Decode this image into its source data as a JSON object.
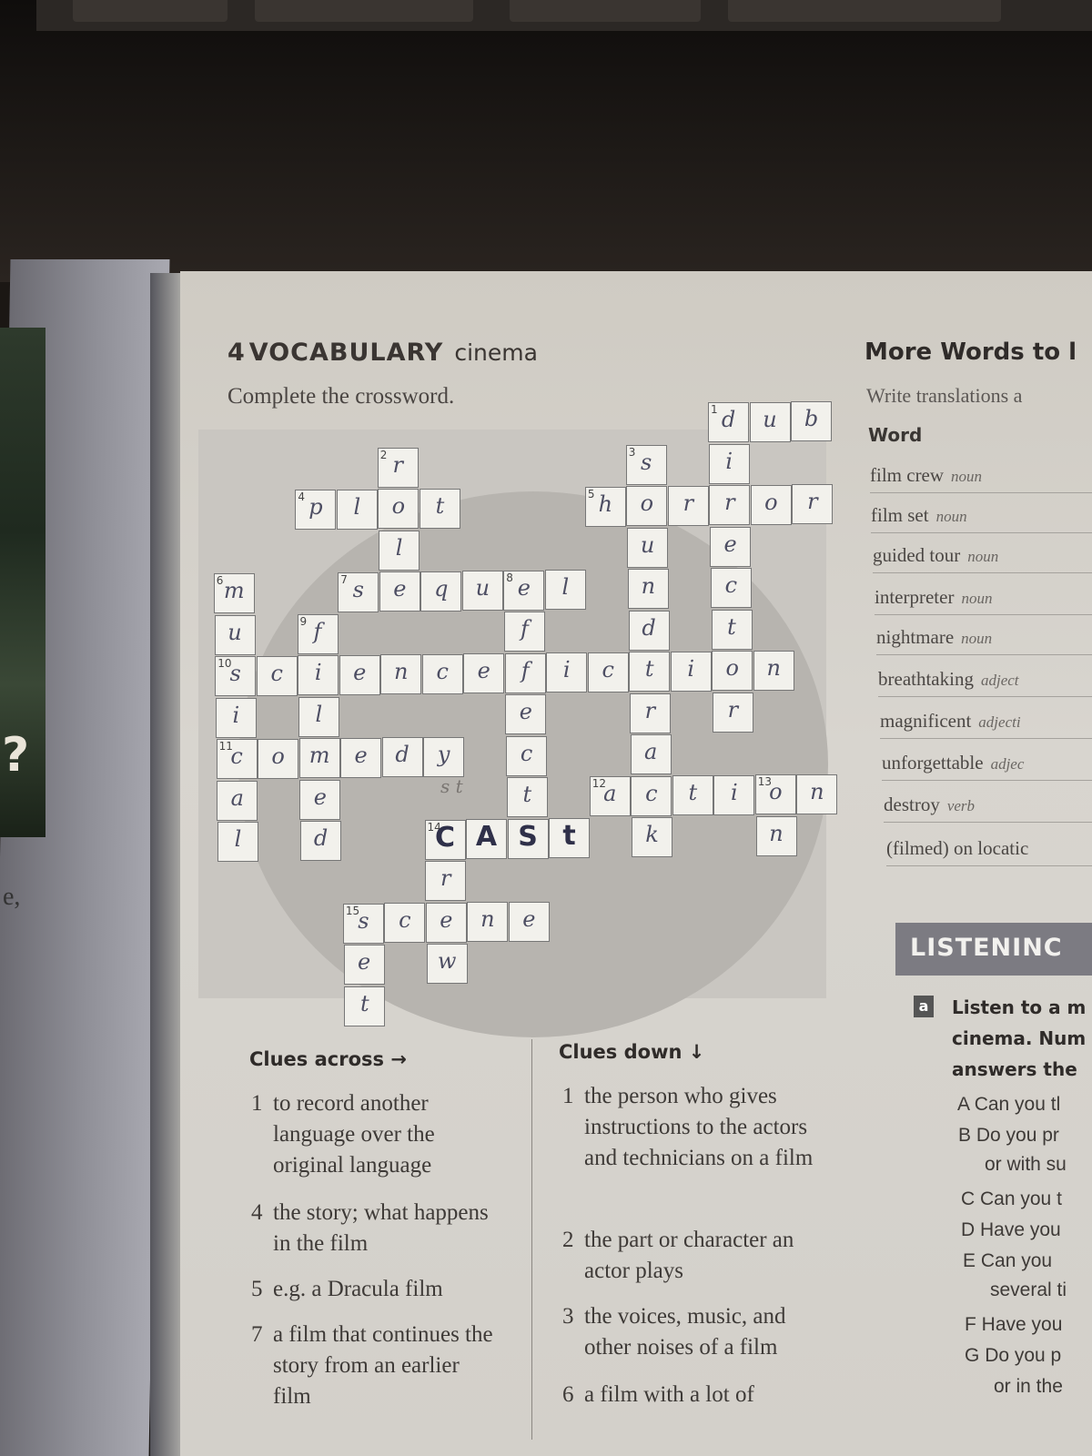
{
  "exercise": {
    "number": "4",
    "title": "VOCABULARY",
    "subtitle": "cinema",
    "instruction": "Complete the crossword."
  },
  "crossword": {
    "pencil_note": "s t",
    "cells": [
      {
        "row": 0,
        "col": 12,
        "num": "1",
        "letter": "d"
      },
      {
        "row": 0,
        "col": 13,
        "num": "",
        "letter": "u"
      },
      {
        "row": 0,
        "col": 14,
        "num": "",
        "letter": "b"
      },
      {
        "row": 1,
        "col": 4,
        "num": "2",
        "letter": "r"
      },
      {
        "row": 1,
        "col": 10,
        "num": "3",
        "letter": "s"
      },
      {
        "row": 1,
        "col": 12,
        "num": "",
        "letter": "i"
      },
      {
        "row": 2,
        "col": 2,
        "num": "4",
        "letter": "p"
      },
      {
        "row": 2,
        "col": 3,
        "num": "",
        "letter": "l"
      },
      {
        "row": 2,
        "col": 4,
        "num": "",
        "letter": "o"
      },
      {
        "row": 2,
        "col": 5,
        "num": "",
        "letter": "t"
      },
      {
        "row": 2,
        "col": 9,
        "num": "5",
        "letter": "h"
      },
      {
        "row": 2,
        "col": 10,
        "num": "",
        "letter": "o"
      },
      {
        "row": 2,
        "col": 11,
        "num": "",
        "letter": "r"
      },
      {
        "row": 2,
        "col": 12,
        "num": "",
        "letter": "r"
      },
      {
        "row": 2,
        "col": 13,
        "num": "",
        "letter": "o"
      },
      {
        "row": 2,
        "col": 14,
        "num": "",
        "letter": "r"
      },
      {
        "row": 3,
        "col": 4,
        "num": "",
        "letter": "l"
      },
      {
        "row": 3,
        "col": 10,
        "num": "",
        "letter": "u"
      },
      {
        "row": 3,
        "col": 12,
        "num": "",
        "letter": "e"
      },
      {
        "row": 4,
        "col": 0,
        "num": "6",
        "letter": "m"
      },
      {
        "row": 4,
        "col": 3,
        "num": "7",
        "letter": "s"
      },
      {
        "row": 4,
        "col": 4,
        "num": "",
        "letter": "e"
      },
      {
        "row": 4,
        "col": 5,
        "num": "",
        "letter": "q"
      },
      {
        "row": 4,
        "col": 6,
        "num": "",
        "letter": "u"
      },
      {
        "row": 4,
        "col": 7,
        "num": "8",
        "letter": "e"
      },
      {
        "row": 4,
        "col": 8,
        "num": "",
        "letter": "l"
      },
      {
        "row": 4,
        "col": 10,
        "num": "",
        "letter": "n"
      },
      {
        "row": 4,
        "col": 12,
        "num": "",
        "letter": "c"
      },
      {
        "row": 5,
        "col": 0,
        "num": "",
        "letter": "u"
      },
      {
        "row": 5,
        "col": 2,
        "num": "9",
        "letter": "f"
      },
      {
        "row": 5,
        "col": 7,
        "num": "",
        "letter": "f"
      },
      {
        "row": 5,
        "col": 10,
        "num": "",
        "letter": "d"
      },
      {
        "row": 5,
        "col": 12,
        "num": "",
        "letter": "t"
      },
      {
        "row": 6,
        "col": 0,
        "num": "10",
        "letter": "s"
      },
      {
        "row": 6,
        "col": 1,
        "num": "",
        "letter": "c"
      },
      {
        "row": 6,
        "col": 2,
        "num": "",
        "letter": "i"
      },
      {
        "row": 6,
        "col": 3,
        "num": "",
        "letter": "e"
      },
      {
        "row": 6,
        "col": 4,
        "num": "",
        "letter": "n"
      },
      {
        "row": 6,
        "col": 5,
        "num": "",
        "letter": "c"
      },
      {
        "row": 6,
        "col": 6,
        "num": "",
        "letter": "e"
      },
      {
        "row": 6,
        "col": 7,
        "num": "",
        "letter": "f"
      },
      {
        "row": 6,
        "col": 8,
        "num": "",
        "letter": "i"
      },
      {
        "row": 6,
        "col": 9,
        "num": "",
        "letter": "c"
      },
      {
        "row": 6,
        "col": 10,
        "num": "",
        "letter": "t"
      },
      {
        "row": 6,
        "col": 11,
        "num": "",
        "letter": "i"
      },
      {
        "row": 6,
        "col": 12,
        "num": "",
        "letter": "o"
      },
      {
        "row": 6,
        "col": 13,
        "num": "",
        "letter": "n"
      },
      {
        "row": 7,
        "col": 0,
        "num": "",
        "letter": "i"
      },
      {
        "row": 7,
        "col": 2,
        "num": "",
        "letter": "l"
      },
      {
        "row": 7,
        "col": 7,
        "num": "",
        "letter": "e"
      },
      {
        "row": 7,
        "col": 10,
        "num": "",
        "letter": "r"
      },
      {
        "row": 7,
        "col": 12,
        "num": "",
        "letter": "r"
      },
      {
        "row": 8,
        "col": 0,
        "num": "11",
        "letter": "c"
      },
      {
        "row": 8,
        "col": 1,
        "num": "",
        "letter": "o"
      },
      {
        "row": 8,
        "col": 2,
        "num": "",
        "letter": "m"
      },
      {
        "row": 8,
        "col": 3,
        "num": "",
        "letter": "e"
      },
      {
        "row": 8,
        "col": 4,
        "num": "",
        "letter": "d"
      },
      {
        "row": 8,
        "col": 5,
        "num": "",
        "letter": "y"
      },
      {
        "row": 8,
        "col": 7,
        "num": "",
        "letter": "c"
      },
      {
        "row": 8,
        "col": 10,
        "num": "",
        "letter": "a"
      },
      {
        "row": 9,
        "col": 0,
        "num": "",
        "letter": "a"
      },
      {
        "row": 9,
        "col": 2,
        "num": "",
        "letter": "e"
      },
      {
        "row": 9,
        "col": 7,
        "num": "",
        "letter": "t"
      },
      {
        "row": 9,
        "col": 9,
        "num": "12",
        "letter": "a"
      },
      {
        "row": 9,
        "col": 10,
        "num": "",
        "letter": "c"
      },
      {
        "row": 9,
        "col": 11,
        "num": "",
        "letter": "t"
      },
      {
        "row": 9,
        "col": 12,
        "num": "",
        "letter": "i"
      },
      {
        "row": 9,
        "col": 13,
        "num": "13",
        "letter": "o"
      },
      {
        "row": 9,
        "col": 14,
        "num": "",
        "letter": "n"
      },
      {
        "row": 10,
        "col": 0,
        "num": "",
        "letter": "l"
      },
      {
        "row": 10,
        "col": 2,
        "num": "",
        "letter": "d"
      },
      {
        "row": 10,
        "col": 5,
        "num": "14",
        "letter": "C",
        "cap": true
      },
      {
        "row": 10,
        "col": 6,
        "num": "",
        "letter": "A",
        "cap": true
      },
      {
        "row": 10,
        "col": 7,
        "num": "",
        "letter": "S",
        "cap": true
      },
      {
        "row": 10,
        "col": 8,
        "num": "",
        "letter": "t",
        "cap": true
      },
      {
        "row": 10,
        "col": 10,
        "num": "",
        "letter": "k"
      },
      {
        "row": 10,
        "col": 13,
        "num": "",
        "letter": "n"
      },
      {
        "row": 11,
        "col": 5,
        "num": "",
        "letter": "r"
      },
      {
        "row": 12,
        "col": 3,
        "num": "15",
        "letter": "s"
      },
      {
        "row": 12,
        "col": 4,
        "num": "",
        "letter": "c"
      },
      {
        "row": 12,
        "col": 5,
        "num": "",
        "letter": "e"
      },
      {
        "row": 12,
        "col": 6,
        "num": "",
        "letter": "n"
      },
      {
        "row": 12,
        "col": 7,
        "num": "",
        "letter": "e"
      },
      {
        "row": 13,
        "col": 3,
        "num": "",
        "letter": "e"
      },
      {
        "row": 13,
        "col": 5,
        "num": "",
        "letter": "w"
      },
      {
        "row": 14,
        "col": 3,
        "num": "",
        "letter": "t"
      }
    ]
  },
  "clues": {
    "across_heading": "Clues across →",
    "down_heading": "Clues down ↓",
    "across": [
      {
        "num": "1",
        "text": "to record another language over the original language"
      },
      {
        "num": "4",
        "text": "the story; what happens in the film"
      },
      {
        "num": "5",
        "text": "e.g. a Dracula film"
      },
      {
        "num": "7",
        "text": "a film that continues the story from an earlier film"
      }
    ],
    "down": [
      {
        "num": "1",
        "text": "the person who gives instructions to the actors and technicians on a film"
      },
      {
        "num": "2",
        "text": "the part or character an actor plays"
      },
      {
        "num": "3",
        "text": "the voices, music, and other noises of a film"
      },
      {
        "num": "6",
        "text": "a film with a lot of"
      }
    ]
  },
  "more_words": {
    "title": "More Words to l",
    "instruction": "Write translations a",
    "column_header": "Word",
    "items": [
      {
        "word": "film crew",
        "pos": "noun"
      },
      {
        "word": "film set",
        "pos": "noun"
      },
      {
        "word": "guided tour",
        "pos": "noun"
      },
      {
        "word": "interpreter",
        "pos": "noun"
      },
      {
        "word": "nightmare",
        "pos": "noun"
      },
      {
        "word": "breathtaking",
        "pos": "adject"
      },
      {
        "word": "magnificent",
        "pos": "adjecti"
      },
      {
        "word": "unforgettable",
        "pos": "adjec"
      },
      {
        "word": "destroy",
        "pos": "verb"
      },
      {
        "word": "(filmed) on locatic",
        "pos": ""
      }
    ]
  },
  "listening": {
    "title": "LISTENINC",
    "badge": "a",
    "instruction_lines": [
      "Listen to a m",
      "cinema. Num",
      "answers the"
    ],
    "questions": [
      {
        "letter": "A",
        "text": "Can you tl"
      },
      {
        "letter": "B",
        "text": "Do you pr"
      },
      {
        "letter": "",
        "text": "or with su"
      },
      {
        "letter": "C",
        "text": "Can you t"
      },
      {
        "letter": "D",
        "text": "Have you"
      },
      {
        "letter": "E",
        "text": "Can you"
      },
      {
        "letter": "",
        "text": "several ti"
      },
      {
        "letter": "F",
        "text": "Have you"
      },
      {
        "letter": "G",
        "text": "Do you p"
      },
      {
        "letter": "",
        "text": "or in the"
      }
    ]
  },
  "left_page": {
    "glyph": "?",
    "mark": "e,"
  }
}
